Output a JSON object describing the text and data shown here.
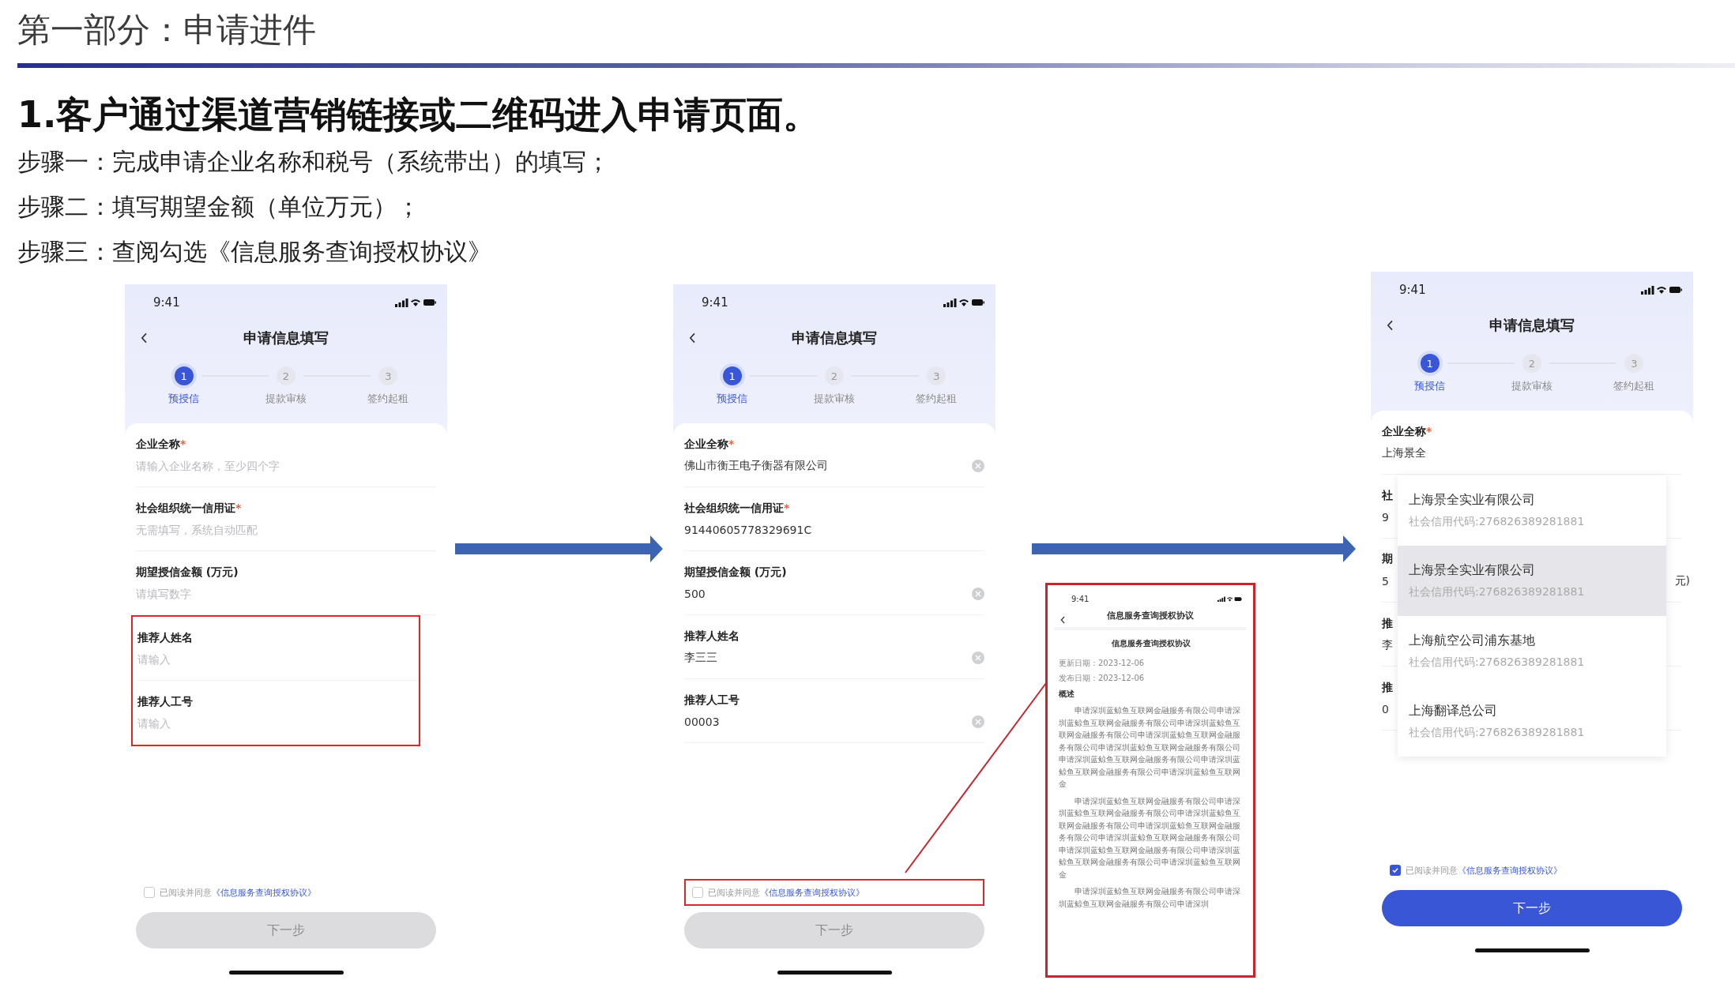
{
  "section_title": "第一部分：申请进件",
  "headline": "1.客户通过渠道营销链接或二维码进入申请页面。",
  "steps": [
    "步骤一：完成申请企业名称和税号（系统带出）的填写；",
    "步骤二：填写期望金额（单位万元）；",
    "步骤三：查阅勾选《信息服务查询授权协议》"
  ],
  "phones": [
    {
      "time": "9:41",
      "title": "申请信息填写",
      "stepper": [
        {
          "number": "1",
          "label": "预授信",
          "selected": true
        },
        {
          "number": "2",
          "label": "提款审核",
          "selected": false
        },
        {
          "number": "3",
          "label": "签约起租",
          "selected": false
        }
      ],
      "fields": [
        {
          "label": "企业全称",
          "required_mark": "*",
          "placeholder": "请输入企业名称，至少四个字",
          "clearable": false,
          "highlighted": false
        },
        {
          "label": "社会组织统一信用证",
          "required_mark": "*",
          "placeholder": "无需填写，系统自动匹配",
          "clearable": false,
          "highlighted": false
        },
        {
          "label": "期望授信金额 (万元)",
          "placeholder": "请填写数字",
          "clearable": false,
          "highlighted": false
        },
        {
          "label": "推荐人姓名",
          "placeholder": "请输入",
          "clearable": false,
          "highlighted": true
        },
        {
          "label": "推荐人工号",
          "placeholder": "请输入",
          "clearable": false,
          "highlighted": true
        }
      ],
      "agreement": {
        "prefix": "已阅读并同意",
        "link": "《信息服务查询授权协议》",
        "checked": false,
        "highlighted": false
      },
      "next_button": {
        "label": "下一步",
        "disabled": true
      }
    },
    {
      "time": "9:41",
      "title": "申请信息填写",
      "stepper": [
        {
          "number": "1",
          "label": "预授信",
          "selected": true
        },
        {
          "number": "2",
          "label": "提款审核",
          "selected": false
        },
        {
          "number": "3",
          "label": "签约起租",
          "selected": false
        }
      ],
      "fields": [
        {
          "label": "企业全称",
          "required_mark": "*",
          "value": "佛山市衡王电子衡器有限公司",
          "clearable": true,
          "highlighted": false
        },
        {
          "label": "社会组织统一信用证",
          "required_mark": "*",
          "value": "91440605778329691C",
          "clearable": false,
          "highlighted": false
        },
        {
          "label": "期望授信金额 (万元)",
          "value": "500",
          "clearable": true,
          "highlighted": false
        },
        {
          "label": "推荐人姓名",
          "value": "李三三",
          "clearable": true,
          "highlighted": false
        },
        {
          "label": "推荐人工号",
          "value": "00003",
          "clearable": true,
          "highlighted": false
        }
      ],
      "agreement": {
        "prefix": "已阅读并同意",
        "link": "《信息服务查询授权协议》",
        "checked": false,
        "highlighted": true
      },
      "next_button": {
        "label": "下一步",
        "disabled": true
      }
    },
    {
      "time": "9:41",
      "title": "申请信息填写",
      "stepper": [
        {
          "number": "1",
          "label": "预授信",
          "selected": true
        },
        {
          "number": "2",
          "label": "提款审核",
          "selected": false
        },
        {
          "number": "3",
          "label": "签约起租",
          "selected": false
        }
      ],
      "fields": [
        {
          "label": "企业全称",
          "required_mark": "*",
          "value": "上海景全",
          "clearable": false,
          "highlighted": false
        },
        {
          "label": "社",
          "value": "9",
          "clearable": false,
          "highlighted": false
        },
        {
          "label": "期",
          "value": "5",
          "unit": "元)",
          "clearable": false,
          "highlighted": false
        },
        {
          "label": "推",
          "value": "李",
          "clearable": false,
          "highlighted": false
        },
        {
          "label": "推",
          "value": "0",
          "clearable": false,
          "highlighted": false
        }
      ],
      "suggestions": [
        {
          "name": "上海景全实业有限公司",
          "code": "社会信用代码:276826389281881",
          "highlighted": false
        },
        {
          "name": "上海景全实业有限公司",
          "code": "社会信用代码:276826389281881",
          "highlighted": true
        },
        {
          "name": "上海航空公司浦东基地",
          "code": "社会信用代码:276826389281881",
          "highlighted": false
        },
        {
          "name": "上海翻译总公司",
          "code": "社会信用代码:276826389281881",
          "highlighted": false
        }
      ],
      "agreement": {
        "prefix": "已阅读并同意",
        "link": "《信息服务查询授权协议》",
        "checked": true,
        "highlighted": false
      },
      "next_button": {
        "label": "下一步",
        "disabled": false
      }
    }
  ],
  "agreement_doc": {
    "time": "9:41",
    "title": "信息服务查询授权协议",
    "heading": "信息服务查询授权协议",
    "updated": "更新日期：2023-12-06",
    "published": "发布日期：2023-12-06",
    "section": "概述",
    "paragraphs": [
      "申请深圳蓝鲸鱼互联网金融服务有限公司申请深圳蓝鲸鱼互联网金融服务有限公司申请深圳蓝鲸鱼互联网金融服务有限公司申请深圳蓝鲸鱼互联网金融服务有限公司申请深圳蓝鲸鱼互联网金融服务有限公司申请深圳蓝鲸鱼互联网金融服务有限公司申请深圳蓝鲸鱼互联网金融服务有限公司申请深圳蓝鲸鱼互联网金",
      "申请深圳蓝鲸鱼互联网金融服务有限公司申请深圳蓝鲸鱼互联网金融服务有限公司申请深圳蓝鲸鱼互联网金融服务有限公司申请深圳蓝鲸鱼互联网金融服务有限公司申请深圳蓝鲸鱼互联网金融服务有限公司申请深圳蓝鲸鱼互联网金融服务有限公司申请深圳蓝鲸鱼互联网金融服务有限公司申请深圳蓝鲸鱼互联网金",
      "申请深圳蓝鲸鱼互联网金融服务有限公司申请深圳蓝鲸鱼互联网金融服务有限公司申请深圳"
    ]
  }
}
